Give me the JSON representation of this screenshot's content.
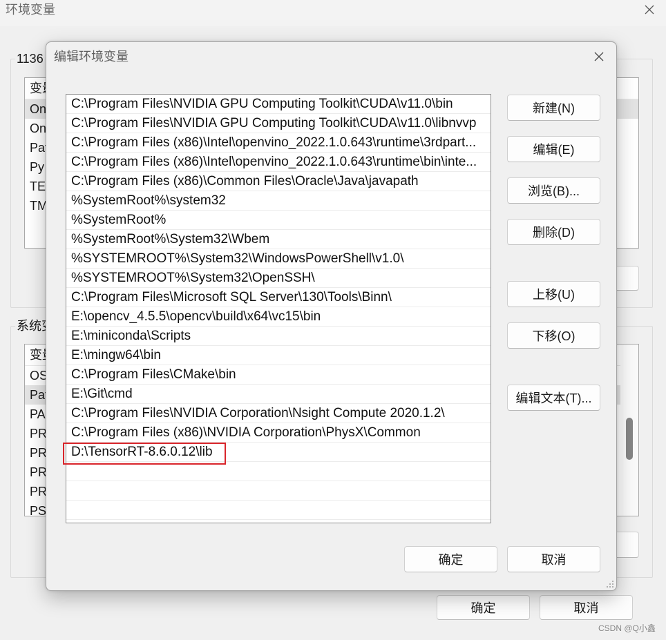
{
  "env_window": {
    "title": "环境变量",
    "close_icon": "close-icon",
    "user_vars": {
      "group_label": "1136",
      "column_header": "变量",
      "rows": [
        "On",
        "On",
        "Pat",
        "Py",
        "TE",
        "TM"
      ]
    },
    "system_vars": {
      "group_label": "系统变",
      "column_header": "变量",
      "rows": [
        "OS",
        "Pat",
        "PA",
        "PR",
        "PR",
        "PR",
        "PR",
        "PSI"
      ]
    },
    "ok_label": "确定",
    "cancel_label": "取消"
  },
  "edit_dialog": {
    "title": "编辑环境变量",
    "close_icon": "close-icon",
    "resize_grip_icon": "resize-grip-icon",
    "path_entries": [
      "C:\\Program Files\\NVIDIA GPU Computing Toolkit\\CUDA\\v11.0\\bin",
      "C:\\Program Files\\NVIDIA GPU Computing Toolkit\\CUDA\\v11.0\\libnvvp",
      "C:\\Program Files (x86)\\Intel\\openvino_2022.1.0.643\\runtime\\3rdpart...",
      "C:\\Program Files (x86)\\Intel\\openvino_2022.1.0.643\\runtime\\bin\\inte...",
      "C:\\Program Files (x86)\\Common Files\\Oracle\\Java\\javapath",
      "%SystemRoot%\\system32",
      "%SystemRoot%",
      "%SystemRoot%\\System32\\Wbem",
      "%SYSTEMROOT%\\System32\\WindowsPowerShell\\v1.0\\",
      "%SYSTEMROOT%\\System32\\OpenSSH\\",
      "C:\\Program Files\\Microsoft SQL Server\\130\\Tools\\Binn\\",
      "E:\\opencv_4.5.5\\opencv\\build\\x64\\vc15\\bin",
      "E:\\miniconda\\Scripts",
      "E:\\mingw64\\bin",
      "C:\\Program Files\\CMake\\bin",
      "E:\\Git\\cmd",
      "C:\\Program Files\\NVIDIA Corporation\\Nsight Compute 2020.1.2\\",
      "C:\\Program Files (x86)\\NVIDIA Corporation\\PhysX\\Common",
      "D:\\TensorRT-8.6.0.12\\lib"
    ],
    "buttons": {
      "new": "新建(N)",
      "edit": "编辑(E)",
      "browse": "浏览(B)...",
      "delete": "删除(D)",
      "move_up": "上移(U)",
      "move_down": "下移(O)",
      "edit_text": "编辑文本(T)..."
    },
    "ok_label": "确定",
    "cancel_label": "取消"
  },
  "colors": {
    "annotation_red": "#d9252b",
    "selection_gray": "#e3e3e3"
  },
  "watermark": "CSDN @Q小鑫"
}
